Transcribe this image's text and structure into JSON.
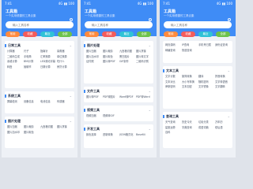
{
  "screens": [
    {
      "status": {
        "time": "7:41",
        "signal": "4G ▮▮ 100"
      },
      "header": {
        "title": "工具箱",
        "subtitle": "一个实用便捷的工具合集"
      },
      "search": {
        "placeholder": "输入工具名称"
      },
      "chips": [
        "常用",
        "收藏",
        "最近",
        "全部"
      ],
      "cards": [
        {
          "title": "日常工具",
          "items": [
            "计算器",
            "尺子",
            "指南针",
            "量角器",
            "二维码生成",
            "手电筒",
            "汇率换算",
            "单位换算",
            "亲戚计算",
            "BMI计算",
            "LED滚动字幕",
            "吃什么",
            "转盘",
            "抛硬币",
            "日期计算",
            "房贷计算"
          ]
        },
        {
          "title": "系统工具",
          "items": [
            "屏幕检测",
            "设备信息",
            "电池信息",
            "传感器"
          ]
        },
        {
          "title": "图片处理",
          "items": [
            "图片压缩",
            "图片裁剪",
            "九宫格切图",
            "图片拼接",
            "图片加水印",
            "图片取色"
          ]
        }
      ]
    },
    {
      "status": {
        "time": "7:41",
        "signal": "4G ▮▮ 100"
      },
      "header": {
        "title": "工具箱",
        "subtitle": "一个实用便捷的工具合集"
      },
      "search": {
        "placeholder": "输入工具名称"
      },
      "chips": [
        "常用",
        "收藏",
        "最近",
        "全部"
      ],
      "cards": [
        {
          "title": "图片处理",
          "items": [
            "图片压缩",
            "图片裁剪",
            "九宫格切图",
            "图片拼接",
            "图片加水印",
            "图片取色",
            "黑白图片",
            "图片转文字",
            "证件照",
            "图片转PDF",
            "GIF制作",
            "二维码识别"
          ]
        },
        {
          "title": "文件工具",
          "items": [
            "图片转PDF",
            "PDF转图片",
            "Word转PDF",
            "PDF转Word"
          ]
        },
        {
          "title": "视频工具",
          "items": [
            "视频压缩",
            "视频转GIF"
          ]
        },
        {
          "title": "开发工具",
          "items": [
            "颜色选择",
            "进制转换",
            "JSON格式化",
            "Base64"
          ]
        }
      ]
    },
    {
      "status": {
        "time": "7:41",
        "signal": "4G ▮▮ 100"
      },
      "header": {
        "title": "工具箱",
        "subtitle": "一个实用便捷的工具合集"
      },
      "search": {
        "placeholder": "输入工具名称"
      },
      "chips": [
        "常用",
        "收藏",
        "最近",
        "全部"
      ],
      "cards": [
        {
          "title": "",
          "items": [
            "网页源码",
            "IP查询",
            "手机号归属",
            "身份证查询",
            "邮编查询",
            "快递查询"
          ]
        },
        {
          "title": "文本工具",
          "items": [
            "文字计数",
            "繁简转换",
            "翻译",
            "拼音转换",
            "文本对比",
            "大小写转换",
            "随机密码",
            "文字转语音",
            "摩斯密码",
            "文本加密",
            "文字镜像",
            "文字翻转"
          ]
        },
        {
          "title": "查询工具",
          "items": [
            "天气查询",
            "历史今天",
            "垃圾分类",
            "万年历",
            "星座运势",
            "字典查询",
            "成语词典",
            "歇后语",
            "百科"
          ]
        }
      ]
    }
  ],
  "colors": {
    "primary": "#3f8cf6",
    "background": "#eef1f6"
  }
}
